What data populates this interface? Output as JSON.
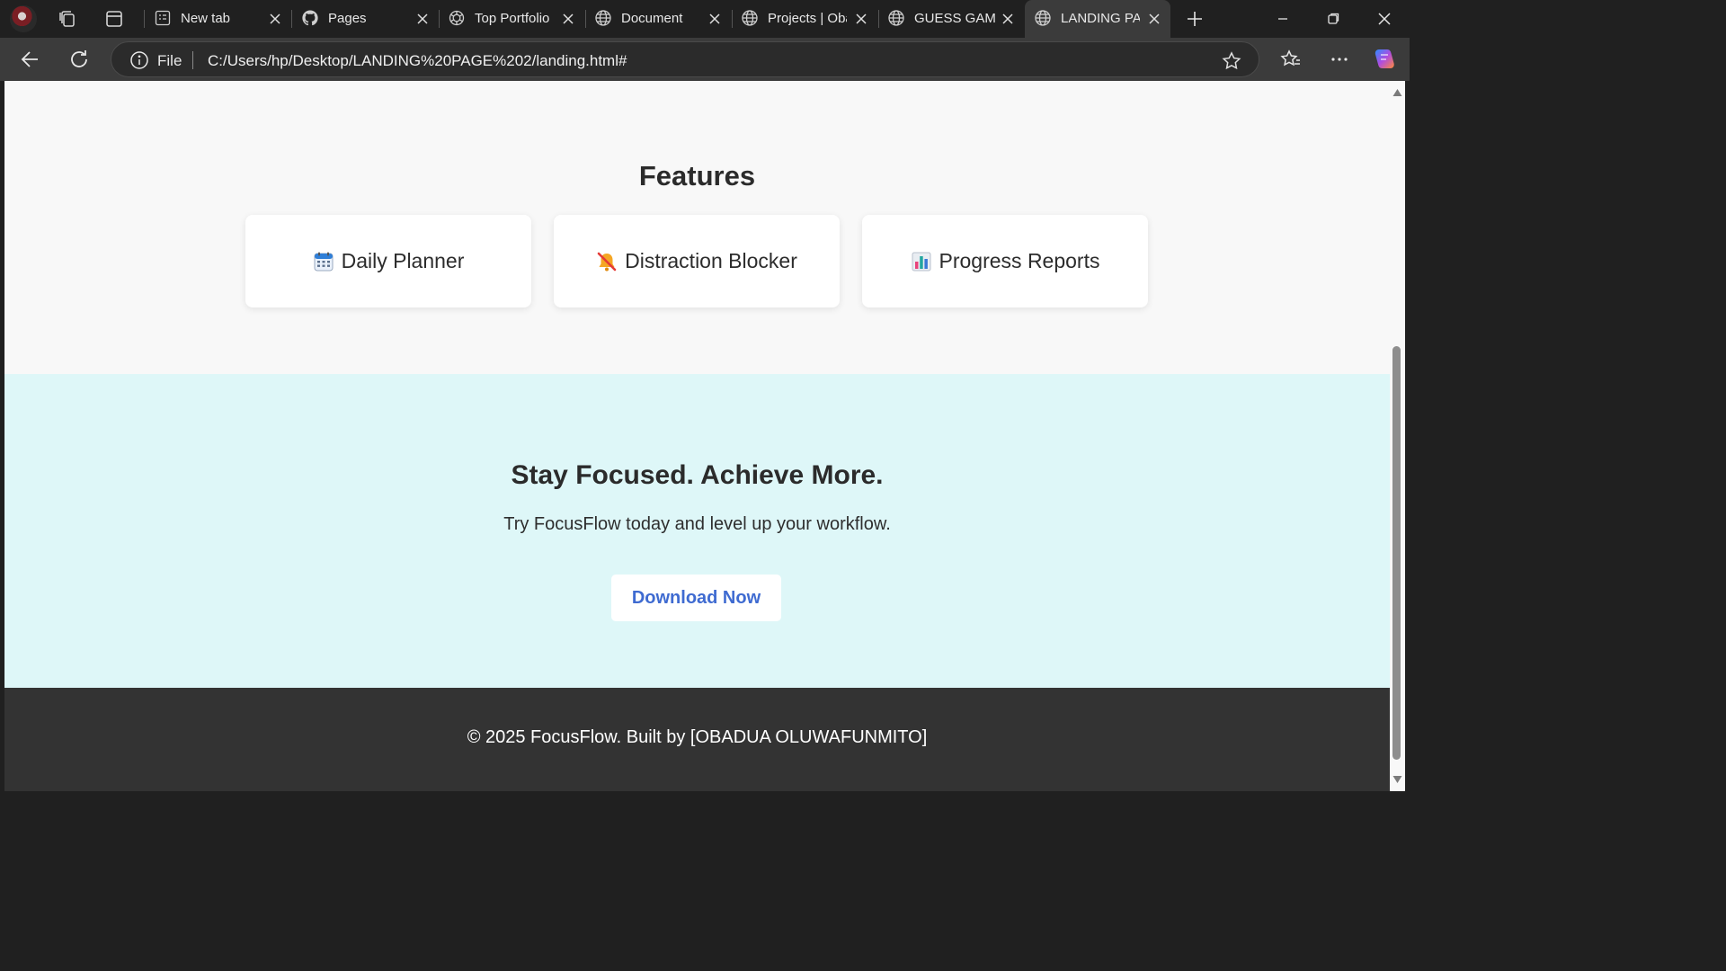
{
  "browser": {
    "tabs": [
      {
        "label": "New tab",
        "icon": "new-tab-icon",
        "active": false
      },
      {
        "label": "Pages",
        "icon": "github-icon",
        "active": false
      },
      {
        "label": "Top Portfolio",
        "icon": "openai-icon",
        "active": false
      },
      {
        "label": "Document",
        "icon": "globe-icon",
        "active": false
      },
      {
        "label": "Projects | Oba",
        "icon": "globe-icon",
        "active": false
      },
      {
        "label": "GUESS GAME",
        "icon": "globe-icon",
        "active": false
      },
      {
        "label": "LANDING PAG",
        "icon": "globe-icon",
        "active": true
      }
    ],
    "address": {
      "scheme_label": "File",
      "url": "C:/Users/hp/Desktop/LANDING%20PAGE%202/landing.html#"
    }
  },
  "page": {
    "features": {
      "title": "Features",
      "cards": [
        {
          "icon": "calendar-icon",
          "label": "Daily Planner"
        },
        {
          "icon": "muted-bell-icon",
          "label": "Distraction Blocker"
        },
        {
          "icon": "bar-chart-icon",
          "label": "Progress Reports"
        }
      ]
    },
    "cta": {
      "title": "Stay Focused. Achieve More.",
      "subtitle": "Try FocusFlow today and level up your workflow.",
      "button_label": "Download Now"
    },
    "footer": {
      "text": "© 2025 FocusFlow. Built by [OBADUA OLUWAFUNMITO]"
    }
  },
  "colors": {
    "features_bg": "#f8f8f8",
    "cta_bg": "#def7f8",
    "footer_bg": "#333333",
    "button_text": "#3f6bd1"
  }
}
